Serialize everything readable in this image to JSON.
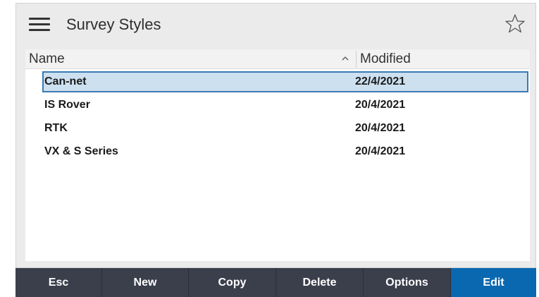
{
  "header": {
    "title": "Survey Styles",
    "menu_icon": "hamburger-menu-icon",
    "favorite_icon": "star-outline-icon"
  },
  "list": {
    "columns": {
      "name": "Name",
      "modified": "Modified",
      "sort_indicator": "^"
    },
    "rows": [
      {
        "name": "Can-net",
        "modified": "22/4/2021",
        "selected": true
      },
      {
        "name": "IS Rover",
        "modified": "20/4/2021",
        "selected": false
      },
      {
        "name": "RTK",
        "modified": "20/4/2021",
        "selected": false
      },
      {
        "name": "VX & S Series",
        "modified": "20/4/2021",
        "selected": false
      }
    ]
  },
  "toolbar": {
    "esc": "Esc",
    "new": "New",
    "copy": "Copy",
    "delete": "Delete",
    "options": "Options",
    "edit": "Edit"
  },
  "colors": {
    "toolbar_bg": "#3b3f4c",
    "primary_button": "#0a68b0",
    "selection_bg": "#cce0f0",
    "selection_border": "#3a7ab0"
  }
}
